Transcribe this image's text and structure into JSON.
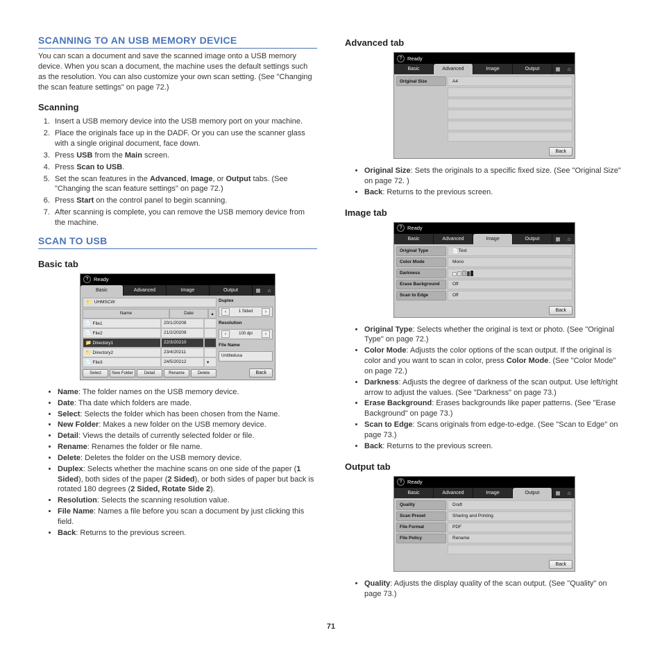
{
  "page_number": "71",
  "left": {
    "h1_scanusb": "SCANNING TO AN USB MEMORY DEVICE",
    "intro": "You can scan a document and save the scanned image onto a USB memory device. When you scan a document, the machine uses the default settings such as the resolution. You can also customize your own scan setting. (See \"Changing the scan feature settings\" on page 72.)",
    "h2_scanning": "Scanning",
    "steps": [
      "Insert a USB memory device into the USB memory port on your machine.",
      "Place the originals face up in the DADF. Or you can use the scanner glass with a single original document, face down.",
      "Press <b>USB</b> from the <b>Main</b> screen.",
      "Press <b>Scan to USB</b>.",
      "Set the scan features in the <b>Advanced</b>, <b>Image</b>, or <b>Output</b> tabs. (See \"Changing the scan feature settings\" on page 72.)",
      "Press <b>Start</b> on the control panel to begin scanning.",
      "After scanning is complete, you can remove the USB memory device from the machine."
    ],
    "h1_scantousb": "SCAN TO USB",
    "h2_basic": "Basic tab",
    "basic_panel": {
      "ready": "Ready",
      "tabs": [
        "Basic",
        "Advanced",
        "Image",
        "Output"
      ],
      "crumb": "UHMSCW",
      "headers": [
        "Name",
        "Date"
      ],
      "rows": [
        {
          "icon": "file",
          "name": "File1",
          "date": "20/1/20208",
          "sel": false
        },
        {
          "icon": "file",
          "name": "File2",
          "date": "21/2/20209",
          "sel": false
        },
        {
          "icon": "folder",
          "name": "Directory1",
          "date": "22/3/20210",
          "sel": true
        },
        {
          "icon": "folder",
          "name": "Directory2",
          "date": "23/4/20211",
          "sel": false
        },
        {
          "icon": "file",
          "name": "File3",
          "date": "24/5/20212",
          "sel": false
        }
      ],
      "buttons": [
        "Select",
        "New Folder",
        "Detail",
        "Rename",
        "Delete"
      ],
      "duplex_label": "Duplex",
      "duplex_value": "1 Sided",
      "res_label": "Resolution",
      "res_value": "100 dpi",
      "fname_label": "File Name",
      "fname_value": "Untitledusa",
      "back": "Back"
    },
    "basic_bullets": [
      "<b>Name</b>: The folder names on the USB memory device.",
      "<b>Date</b>: Tha date which folders are made.",
      "<b>Select</b>: Selects the folder which has been chosen from the Name.",
      "<b>New Folder</b>: Makes a new folder on the USB memory device.",
      "<b>Detail</b>: Views the details of currently selected folder or file.",
      "<b>Rename</b>: Renames the folder or file name.",
      "<b>Delete</b>: Deletes the folder on the USB memory device.",
      "<b>Duplex</b>: Selects whether the machine scans on one side of the paper (<b>1 Sided</b>), both sides of the paper (<b>2 Sided</b>), or both sides of paper but back is rotated 180 degrees (<b>2 Sided, Rotate Side 2</b>).",
      "<b>Resolution</b>: Selects the scanning resolution value.",
      "<b>File Name</b>: Names a file before you scan a document by just clicking this field.",
      "<b>Back</b>: Returns to the previous screen."
    ]
  },
  "right": {
    "h2_adv": "Advanced tab",
    "adv_panel": {
      "ready": "Ready",
      "tabs": [
        "Basic",
        "Advanced",
        "Image",
        "Output"
      ],
      "rows": [
        {
          "label": "Original Size",
          "value": "A4"
        }
      ],
      "blank_rows": 5,
      "back": "Back"
    },
    "adv_bullets": [
      "<b>Original Size</b>: Sets the originals to a specific fixed size. (See \"Original Size\" on page 72. )",
      "<b>Back</b>: Returns to the previous screen."
    ],
    "h2_image": "Image tab",
    "image_panel": {
      "ready": "Ready",
      "tabs": [
        "Basic",
        "Advanced",
        "Image",
        "Output"
      ],
      "rows": [
        {
          "label": "Original Type",
          "value": "Text",
          "icon": "file"
        },
        {
          "label": "Color Mode",
          "value": "Mono"
        },
        {
          "label": "Darkness",
          "value": "__bars__"
        },
        {
          "label": "Erase Background",
          "value": "Off"
        },
        {
          "label": "Scan to Edge",
          "value": "Off"
        }
      ],
      "back": "Back"
    },
    "image_bullets": [
      "<b>Original Type</b>: Selects whether the original is text or photo. (See \"Original Type\" on page 72.)",
      "<b>Color Mode</b>: Adjusts the color options of the scan output. If the original is color and you want to scan in color, press <b>Color Mode</b>. (See \"Color Mode\" on page 72.)",
      "<b>Darkness</b>: Adjusts the degree of darkness of the scan output. Use left/right arrow to adjust the values. (See \"Darkness\" on page 73.)",
      "<b>Erase Background</b>: Erases backgrounds like paper patterns. (See \"Erase Background\" on page 73.)",
      "<b>Scan to Edge</b>: Scans originals from edge-to-edge. (See \"Scan to Edge\" on page 73.)",
      "<b>Back</b>: Returns to the previous screen."
    ],
    "h2_output": "Output tab",
    "output_panel": {
      "ready": "Ready",
      "tabs": [
        "Basic",
        "Advanced",
        "Image",
        "Output"
      ],
      "rows": [
        {
          "label": "Quality",
          "value": "Draft"
        },
        {
          "label": "Scan Preset",
          "value": "Sharing and Printing"
        },
        {
          "label": "File Format",
          "value": "PDF"
        },
        {
          "label": "File Policy",
          "value": "Rename"
        }
      ],
      "blank_rows": 1,
      "back": "Back"
    },
    "output_bullets": [
      "<b>Quality</b>: Adjusts the display quality of the scan output. (See \"Quality\" on page 73.)"
    ]
  }
}
